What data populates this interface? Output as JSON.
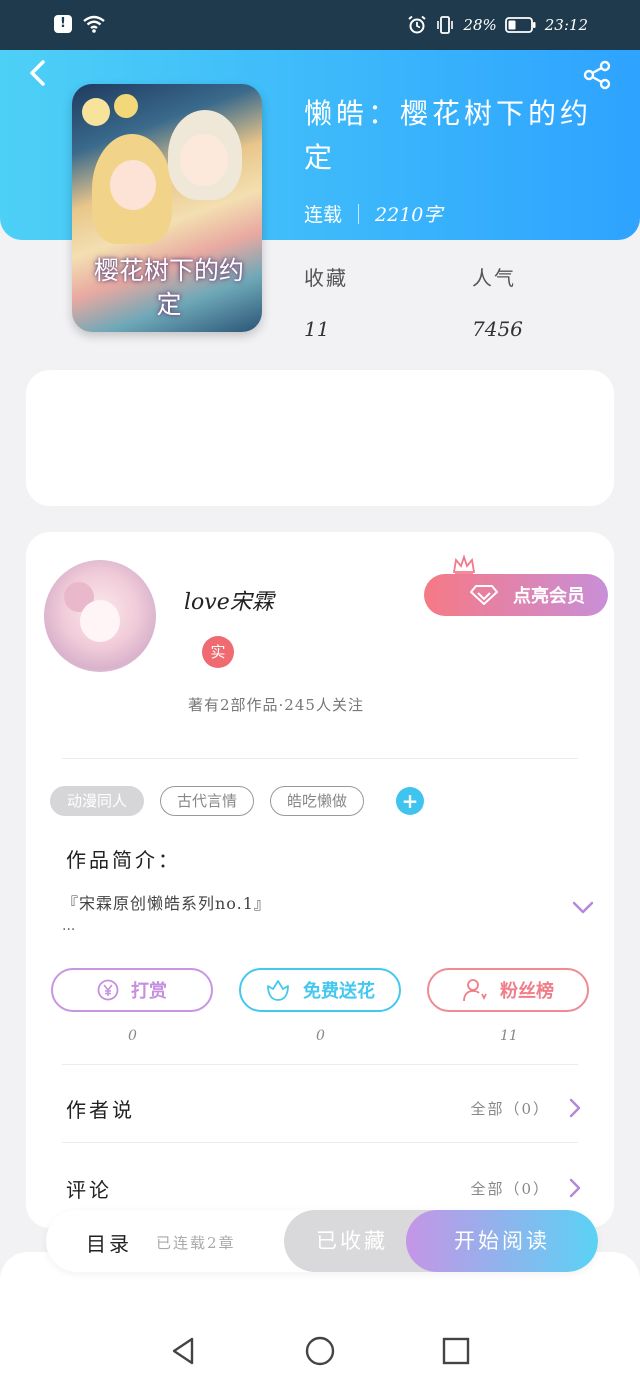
{
  "status_bar": {
    "battery": "28%",
    "time": "23:12"
  },
  "book": {
    "title": "懒皓：樱花树下的约定",
    "cover_text": "樱花树下的约定",
    "status": "连载",
    "word_count": "2210字"
  },
  "stats": {
    "favorites_label": "收藏",
    "favorites_value": "11",
    "popularity_label": "人气",
    "popularity_value": "7456"
  },
  "author": {
    "name": "love宋霖",
    "verified_badge": "实",
    "summary": "著有2部作品·245人关注",
    "vip_button": "点亮会员"
  },
  "tags": [
    "动漫同人",
    "古代言情",
    "皓吃懒做"
  ],
  "intro": {
    "title": "作品简介：",
    "text": "『宋霖原创懒皓系列no.1』",
    "more": "..."
  },
  "actions": [
    {
      "label": "打赏",
      "value": "0",
      "color": "#c68fe0"
    },
    {
      "label": "免费送花",
      "value": "0",
      "color": "#45c8ee"
    },
    {
      "label": "粉丝榜",
      "value": "11",
      "color": "#f07e88"
    }
  ],
  "rows": [
    {
      "label": "作者说",
      "all": "全部（0）"
    },
    {
      "label": "评论",
      "all": "全部（0）"
    }
  ],
  "bottom_bar": {
    "catalog": "目录",
    "updated": "已连载2章",
    "collected": "已收藏",
    "read": "开始阅读"
  }
}
